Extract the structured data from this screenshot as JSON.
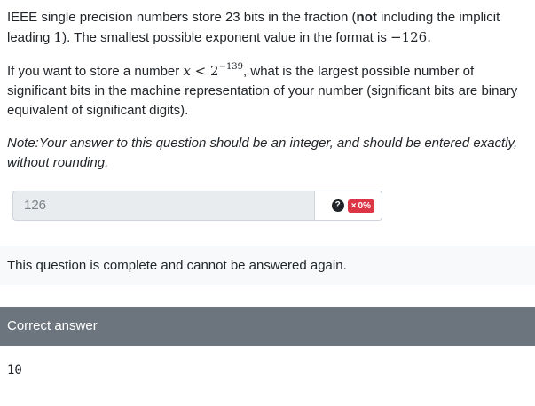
{
  "question": {
    "p1_part1": "IEEE single precision numbers store 23 bits in the fraction (",
    "p1_bold": "not",
    "p1_part2": " including the implicit leading ",
    "p1_math_one": "1",
    "p1_part3": "). The smallest possible exponent value in the format is ",
    "p1_math_exp": "−126",
    "p1_part4": ".",
    "p2_part1": "If you want to store a number ",
    "p2_math_x": "x",
    "p2_math_lt": " < 2",
    "p2_math_sup": "−139",
    "p2_part2": ", what is the largest possible number of significant bits in the machine representation of your number (significant bits are binary equivalent of significant digits).",
    "note": "Note:Your answer to this question should be an integer, and should be entered exactly, without rounding."
  },
  "answer": {
    "value": "126",
    "help_icon": "question-circle-icon",
    "help_glyph": "?",
    "badge_icon": "times-icon",
    "badge_glyph": "×",
    "badge_score": "0%",
    "badge_color": "#dc3545"
  },
  "status": {
    "complete_text": "This question is complete and cannot be answered again."
  },
  "correct": {
    "header": "Correct answer",
    "header_color": "#6c757d",
    "value": "10"
  }
}
